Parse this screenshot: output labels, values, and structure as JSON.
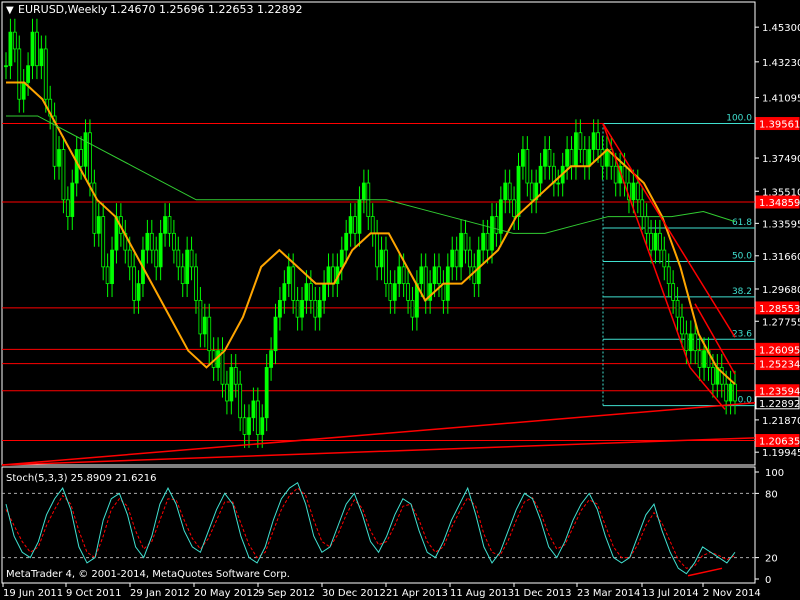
{
  "header": {
    "symbol": "EURUSD,Weekly",
    "ohlc": "1.24670 1.25696 1.22653 1.22892"
  },
  "footer": {
    "copyright": "MetaTrader 4, © 2001-2014, MetaQuotes Software Corp."
  },
  "colors": {
    "background": "#000000",
    "grid": "#ffffff",
    "bull": "#00ff00",
    "bear": "#00ff00",
    "ma_fast": "#ffa500",
    "ma_slow": "#32cd32",
    "hline": "#ff0000",
    "fib": "#40e0d0",
    "stoch_main": "#40e0d0",
    "stoch_signal": "#ff0000",
    "current_price_bg": "#000000"
  },
  "chart_data": [
    {
      "type": "candlestick",
      "title": "EURUSD,Weekly",
      "ylim": [
        1.1918,
        1.468
      ],
      "x_ticks": [
        "19 Jun 2011",
        "9 Oct 2011",
        "29 Jan 2012",
        "20 May 2012",
        "9 Sep 2012",
        "30 Dec 2012",
        "21 Apr 2013",
        "11 Aug 2013",
        "1 Dec 2013",
        "23 Mar 2014",
        "13 Jul 2014",
        "2 Nov 2014"
      ],
      "y_ticks": [
        "1.45300",
        "1.43230",
        "1.41095",
        "1.37490",
        "1.35510",
        "1.33595",
        "1.31660",
        "1.29680",
        "1.27755",
        "1.21870",
        "1.19945"
      ],
      "price_labels": [
        {
          "text": "1.39561",
          "value": 1.3955
        },
        {
          "text": "1.34859",
          "value": 1.3487
        },
        {
          "text": "1.28553",
          "value": 1.2855
        },
        {
          "text": "1.26095",
          "value": 1.2608
        },
        {
          "text": "1.25234",
          "value": 1.2523
        },
        {
          "text": "1.23594",
          "value": 1.2361
        },
        {
          "text": "1.22892",
          "value": 1.2289,
          "current": true
        },
        {
          "text": "1.20635",
          "value": 1.2064
        }
      ],
      "horizontal_lines": [
        1.3955,
        1.3487,
        1.2855,
        1.2608,
        1.2523,
        1.2361,
        1.2064
      ],
      "fibonacci": {
        "high": 1.3955,
        "low": 1.2272,
        "levels": [
          {
            "label": "100.0",
            "value": 1.3955
          },
          {
            "label": "61.8",
            "value": 1.3332
          },
          {
            "label": "50.0",
            "value": 1.3132
          },
          {
            "label": "38.2",
            "value": 1.2921
          },
          {
            "label": "23.6",
            "value": 1.2668
          },
          {
            "label": "0.0",
            "value": 1.2272
          }
        ]
      },
      "series": [
        {
          "name": "EURUSD close",
          "values": [
            1.43,
            1.45,
            1.44,
            1.41,
            1.42,
            1.43,
            1.45,
            1.43,
            1.44,
            1.41,
            1.4,
            1.37,
            1.38,
            1.35,
            1.34,
            1.36,
            1.38,
            1.37,
            1.39,
            1.36,
            1.33,
            1.34,
            1.31,
            1.3,
            1.32,
            1.34,
            1.33,
            1.32,
            1.31,
            1.29,
            1.3,
            1.32,
            1.33,
            1.32,
            1.31,
            1.33,
            1.34,
            1.33,
            1.32,
            1.31,
            1.3,
            1.32,
            1.31,
            1.29,
            1.27,
            1.28,
            1.26,
            1.25,
            1.26,
            1.24,
            1.23,
            1.25,
            1.24,
            1.22,
            1.21,
            1.22,
            1.23,
            1.21,
            1.22,
            1.25,
            1.26,
            1.28,
            1.29,
            1.3,
            1.31,
            1.29,
            1.28,
            1.29,
            1.3,
            1.29,
            1.28,
            1.29,
            1.3,
            1.31,
            1.3,
            1.31,
            1.32,
            1.33,
            1.34,
            1.33,
            1.35,
            1.36,
            1.34,
            1.33,
            1.31,
            1.32,
            1.3,
            1.29,
            1.3,
            1.31,
            1.3,
            1.29,
            1.28,
            1.3,
            1.31,
            1.29,
            1.3,
            1.31,
            1.3,
            1.29,
            1.31,
            1.32,
            1.31,
            1.33,
            1.32,
            1.31,
            1.3,
            1.32,
            1.33,
            1.32,
            1.34,
            1.33,
            1.35,
            1.36,
            1.35,
            1.34,
            1.37,
            1.38,
            1.36,
            1.35,
            1.36,
            1.37,
            1.38,
            1.37,
            1.36,
            1.36,
            1.37,
            1.38,
            1.37,
            1.39,
            1.38,
            1.37,
            1.38,
            1.39,
            1.38,
            1.37,
            1.38,
            1.37,
            1.36,
            1.37,
            1.36,
            1.35,
            1.36,
            1.35,
            1.34,
            1.33,
            1.32,
            1.33,
            1.32,
            1.31,
            1.3,
            1.29,
            1.28,
            1.27,
            1.26,
            1.27,
            1.26,
            1.25,
            1.26,
            1.25,
            1.24,
            1.25,
            1.24,
            1.23,
            1.24,
            1.23
          ]
        },
        {
          "name": "MA fast",
          "values": [
            1.42,
            1.42,
            1.41,
            1.39,
            1.37,
            1.35,
            1.34,
            1.32,
            1.3,
            1.28,
            1.26,
            1.25,
            1.26,
            1.28,
            1.31,
            1.32,
            1.31,
            1.3,
            1.3,
            1.32,
            1.33,
            1.33,
            1.31,
            1.29,
            1.3,
            1.3,
            1.31,
            1.32,
            1.34,
            1.35,
            1.36,
            1.37,
            1.37,
            1.38,
            1.37,
            1.36,
            1.34,
            1.31,
            1.27,
            1.25,
            1.24
          ]
        },
        {
          "name": "MA slow",
          "values": [
            1.4,
            1.4,
            1.39,
            1.38,
            1.37,
            1.36,
            1.35,
            1.35,
            1.35,
            1.35,
            1.35,
            1.35,
            1.35,
            1.345,
            1.34,
            1.335,
            1.33,
            1.33,
            1.335,
            1.34,
            1.34,
            1.34,
            1.343,
            1.337
          ]
        }
      ]
    },
    {
      "type": "line",
      "title": "Stoch(5,3,3) 25.8909 21.6216",
      "ylim": [
        0,
        100
      ],
      "levels": [
        {
          "label": "100",
          "value": 100
        },
        {
          "label": "80",
          "value": 80
        },
        {
          "label": "20",
          "value": 20
        },
        {
          "label": "0",
          "value": 0
        }
      ],
      "series": [
        {
          "name": "main",
          "values": [
            70,
            40,
            25,
            20,
            35,
            60,
            75,
            85,
            65,
            30,
            15,
            20,
            55,
            75,
            80,
            60,
            30,
            20,
            40,
            70,
            85,
            70,
            45,
            30,
            25,
            45,
            65,
            80,
            70,
            40,
            20,
            15,
            30,
            55,
            75,
            85,
            90,
            70,
            40,
            25,
            30,
            50,
            70,
            80,
            60,
            35,
            25,
            40,
            60,
            75,
            70,
            45,
            25,
            20,
            35,
            55,
            70,
            85,
            60,
            30,
            15,
            25,
            45,
            65,
            80,
            75,
            55,
            30,
            20,
            35,
            55,
            70,
            80,
            65,
            40,
            20,
            15,
            20,
            40,
            60,
            70,
            45,
            25,
            10,
            5,
            15,
            30,
            25,
            20,
            15,
            25
          ]
        },
        {
          "name": "signal",
          "values": [
            65,
            50,
            35,
            25,
            30,
            50,
            65,
            78,
            70,
            45,
            25,
            20,
            40,
            65,
            75,
            68,
            45,
            28,
            35,
            55,
            75,
            74,
            55,
            38,
            28,
            38,
            55,
            72,
            72,
            52,
            32,
            20,
            25,
            45,
            65,
            78,
            85,
            78,
            55,
            35,
            30,
            42,
            60,
            74,
            66,
            45,
            32,
            35,
            50,
            68,
            70,
            55,
            35,
            25,
            30,
            48,
            63,
            76,
            68,
            42,
            25,
            22,
            36,
            55,
            72,
            76,
            62,
            42,
            28,
            32,
            48,
            64,
            74,
            70,
            50,
            30,
            20,
            20,
            32,
            50,
            62,
            52,
            35,
            18,
            10,
            12,
            22,
            25,
            22,
            18,
            22
          ]
        }
      ]
    }
  ]
}
